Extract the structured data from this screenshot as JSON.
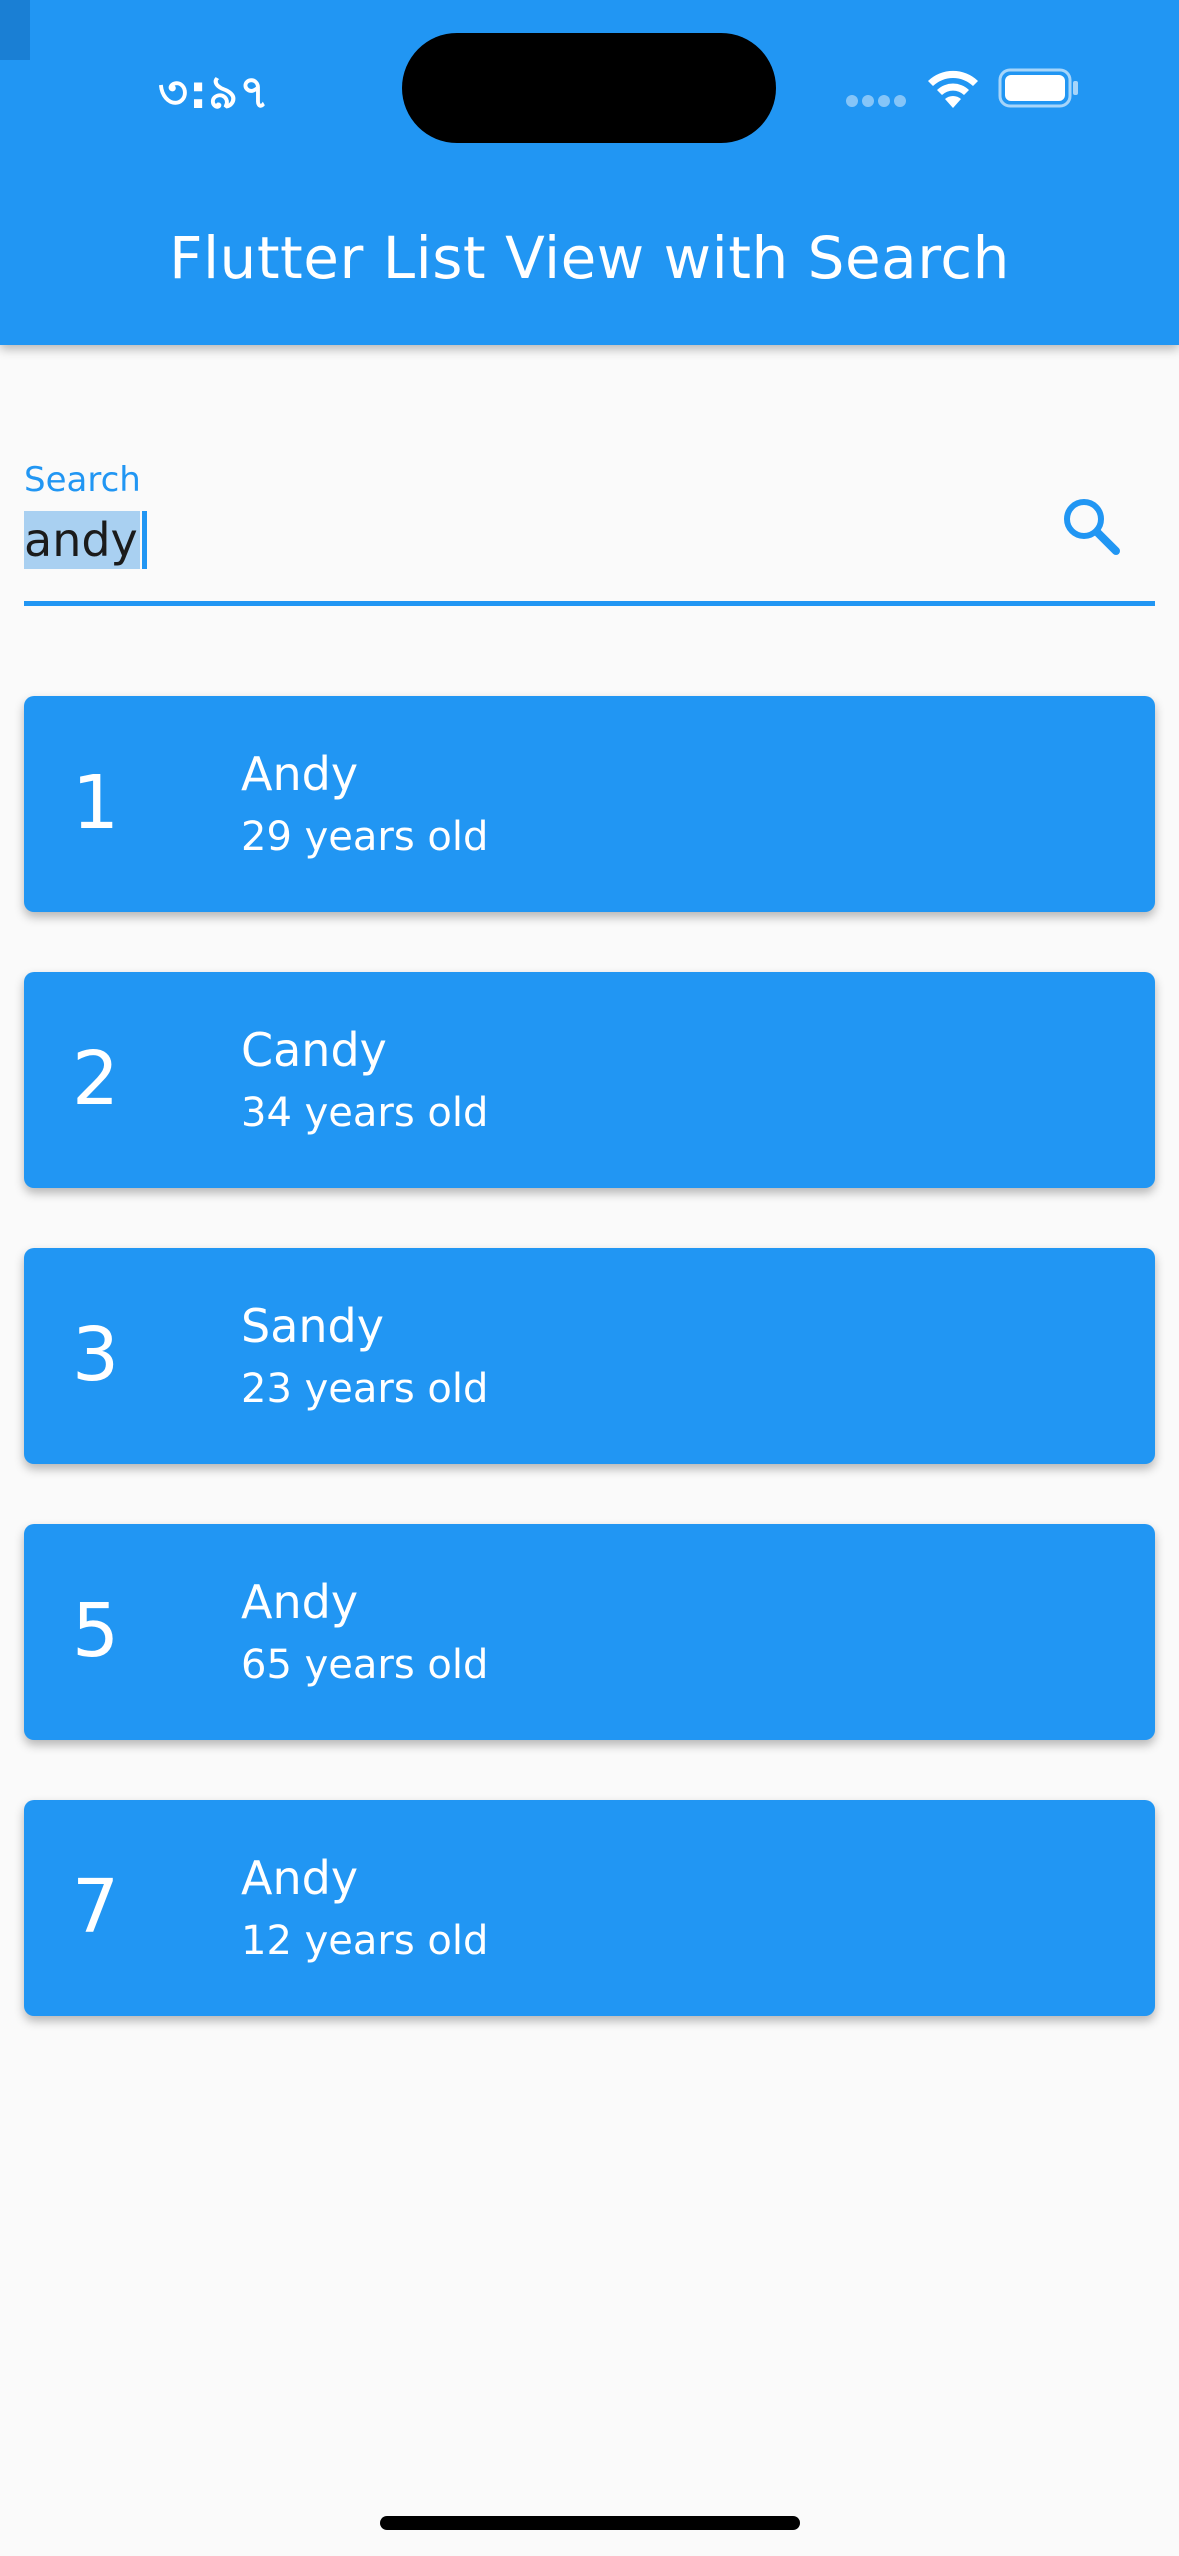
{
  "status_bar": {
    "time": "৩:৯৭",
    "signal_icon": "cellular-signal-icon",
    "wifi_icon": "wifi-icon",
    "battery_icon": "battery-icon"
  },
  "app_bar": {
    "title": "Flutter List View with Search"
  },
  "search": {
    "label": "Search",
    "value": "andy",
    "icon": "search-icon"
  },
  "results": [
    {
      "id": "1",
      "name": "Andy",
      "age": "29 years old"
    },
    {
      "id": "2",
      "name": "Candy",
      "age": "34 years old"
    },
    {
      "id": "3",
      "name": "Sandy",
      "age": "23 years old"
    },
    {
      "id": "5",
      "name": "Andy",
      "age": "65 years old"
    },
    {
      "id": "7",
      "name": "Andy",
      "age": "12 years old"
    }
  ],
  "colors": {
    "primary": "#2196f3",
    "background": "#fafafa",
    "selection": "#a9d0f1"
  }
}
